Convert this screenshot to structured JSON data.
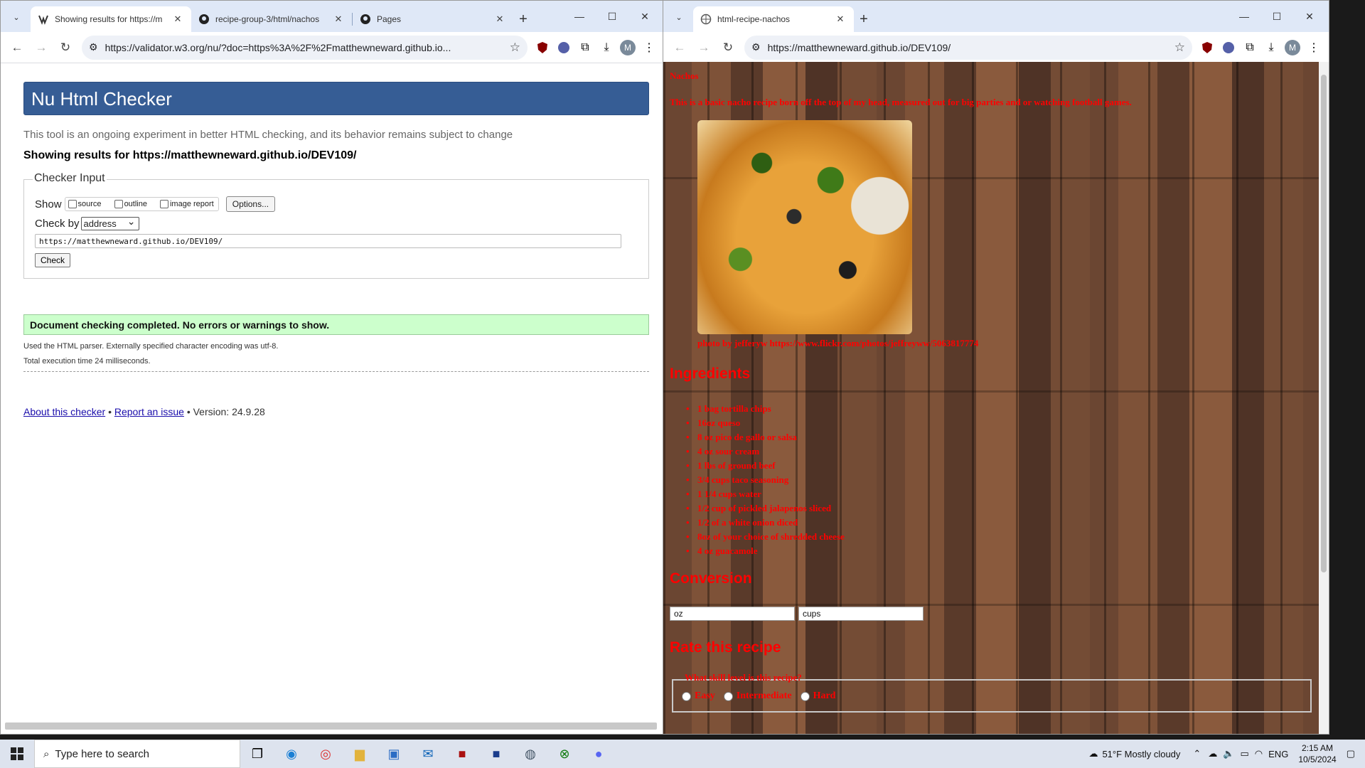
{
  "left_window": {
    "tabs": [
      {
        "title": "Showing results for https://m",
        "active": true
      },
      {
        "title": "recipe-group-3/html/nachos",
        "active": false
      },
      {
        "title": "Pages",
        "active": false
      }
    ],
    "url": "https://validator.w3.org/nu/?doc=https%3A%2F%2Fmatthewneward.github.io...",
    "avatar": "M",
    "page": {
      "header": "Nu Html Checker",
      "tagline": "This tool is an ongoing experiment in better HTML checking, and its behavior remains subject to change",
      "showing": "Showing results for https://matthewneward.github.io/DEV109/",
      "legend": "Checker Input",
      "show_label": "Show",
      "show_options": [
        "source",
        "outline",
        "image report"
      ],
      "options_button": "Options...",
      "check_by_label": "Check by",
      "check_by_value": "address",
      "address_value": "https://matthewneward.github.io/DEV109/",
      "check_button": "Check",
      "success": "Document checking completed. No errors or warnings to show.",
      "info1": "Used the HTML parser. Externally specified character encoding was utf-8.",
      "info2": "Total execution time 24 milliseconds.",
      "footer_about": "About this checker",
      "footer_sep": "•",
      "footer_report": "Report an issue",
      "footer_version": "• Version: 24.9.28"
    }
  },
  "right_window": {
    "tabs": [
      {
        "title": "html-recipe-nachos",
        "active": true
      }
    ],
    "url": "https://matthewneward.github.io/DEV109/",
    "avatar": "M",
    "page": {
      "title": "Nachos",
      "description": "This is a basic nacho recipe born off the top of my head, measured out for big parties and or watching football games.",
      "credit": "photo by jefferyw https://www.flickr.com/photos/jeffreyww/5063817774",
      "ingredients_heading": "Ingredients",
      "ingredients": [
        "1 bag tortilla chips",
        "16oz queso",
        "8 oz pico de gallo or salsa",
        "4 oz sour cream",
        "1 lbs of ground beef",
        "3/4 cups taco seasoning",
        "1 1/4 cups water",
        "1/2 cup of pickled jalapenos sliced",
        "1/2 of a white onion diced",
        "8oz of your choice of shredded cheese",
        "4 oz guacamole"
      ],
      "conversion_heading": "Conversion",
      "conversion_inputs": [
        "oz",
        "cups"
      ],
      "rate_heading": "Rate this recipe",
      "rate_question": "What skill level is this recipe?",
      "rate_options": [
        "Easy",
        "Intermediate",
        "Hard"
      ]
    }
  },
  "taskbar": {
    "search_placeholder": "Type here to search",
    "weather": "51°F  Mostly cloudy",
    "language": "ENG",
    "time": "2:15 AM",
    "date": "10/5/2024"
  }
}
